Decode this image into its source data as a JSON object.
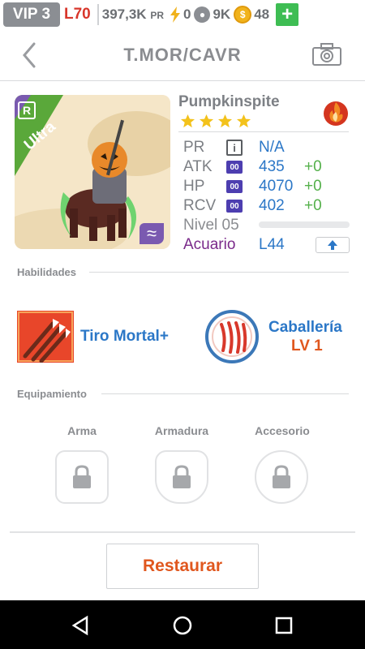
{
  "topbar": {
    "vip": "VIP 3",
    "level": "L70",
    "pr_value": "397,3K",
    "pr_unit": "PR",
    "energy": "0",
    "paws": "9K",
    "coins": "48",
    "plus": "+"
  },
  "header": {
    "title": "T.MOR/CAVR"
  },
  "monster": {
    "name": "Pumpkinspite",
    "rarity": "Ultra",
    "rarity_badge": "R",
    "stars": 4,
    "element": "fire",
    "stats": [
      {
        "label": "PR",
        "value": "N/A",
        "bonus": ""
      },
      {
        "label": "ATK",
        "value": "435",
        "bonus": "+0"
      },
      {
        "label": "HP",
        "value": "4070",
        "bonus": "+0"
      },
      {
        "label": "RCV",
        "value": "402",
        "bonus": "+0"
      }
    ],
    "badge_qual": "00",
    "badge_info": "i",
    "level_text": "Nivel 05",
    "level_progress": 0,
    "aquarium": "Acuario",
    "aquarium_level": "L44"
  },
  "sections": {
    "skills_title": "Habilidades",
    "equip_title": "Equipamiento"
  },
  "skill": {
    "name": "Tiro Mortal+"
  },
  "trait": {
    "name": "Caballería",
    "level": "LV 1"
  },
  "equipment": [
    {
      "label": "Arma"
    },
    {
      "label": "Armadura"
    },
    {
      "label": "Accesorio"
    }
  ],
  "restore_label": "Restaurar",
  "colors": {
    "accent_blue": "#2b77c7",
    "accent_orange": "#e0571e",
    "green": "#54b04a",
    "ultra_green": "#5aa83a",
    "purple": "#7a2a8a"
  }
}
